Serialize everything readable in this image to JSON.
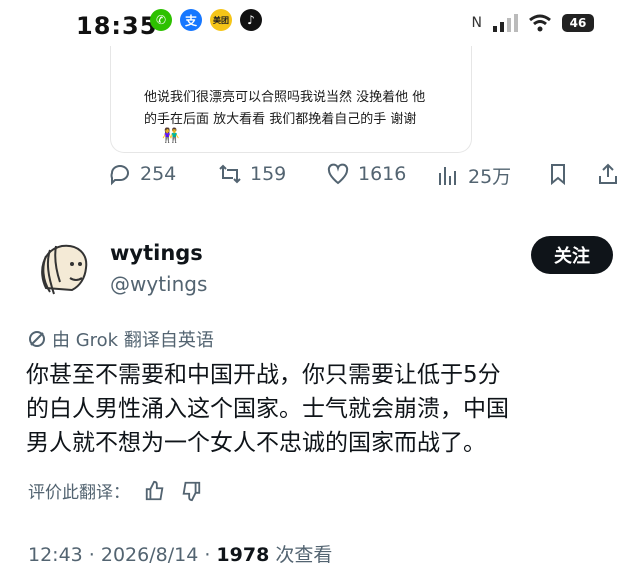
{
  "status_bar": {
    "time": "18:35",
    "apps": [
      "wechat-icon",
      "alipay-icon",
      "meituan-icon",
      "tiktok-icon"
    ],
    "meituan_label": "美团",
    "battery": "46"
  },
  "quoted_post": {
    "line_1": "他说我们很漂亮可以合照吗我说当然 没挽着他 他",
    "line_2": "的手在后面 放大看看 我们都挽着自己的手 谢谢"
  },
  "actions": {
    "replies": "254",
    "reposts": "159",
    "likes": "1616",
    "views": "25万"
  },
  "author": {
    "display_name": "wytings",
    "handle": "@wytings",
    "follow_label": "关注"
  },
  "translation_note": "由 Grok 翻译自英语",
  "post_lines": [
    "你甚至不需要和中国开战，你只需要让低于5分",
    "的白人男性涌入这个国家。士气就会崩溃，中国",
    "男人就不想为一个女人不忠诚的国家而战了。"
  ],
  "rate_translation": "评价此翻译：",
  "meta": {
    "time_date": "12:43 · 2026/8/14 · ",
    "view_count": "1978",
    "view_label": " 次查看"
  },
  "colors": {
    "text": "#0f1419",
    "muted": "#536471",
    "button": "#0f1419"
  }
}
